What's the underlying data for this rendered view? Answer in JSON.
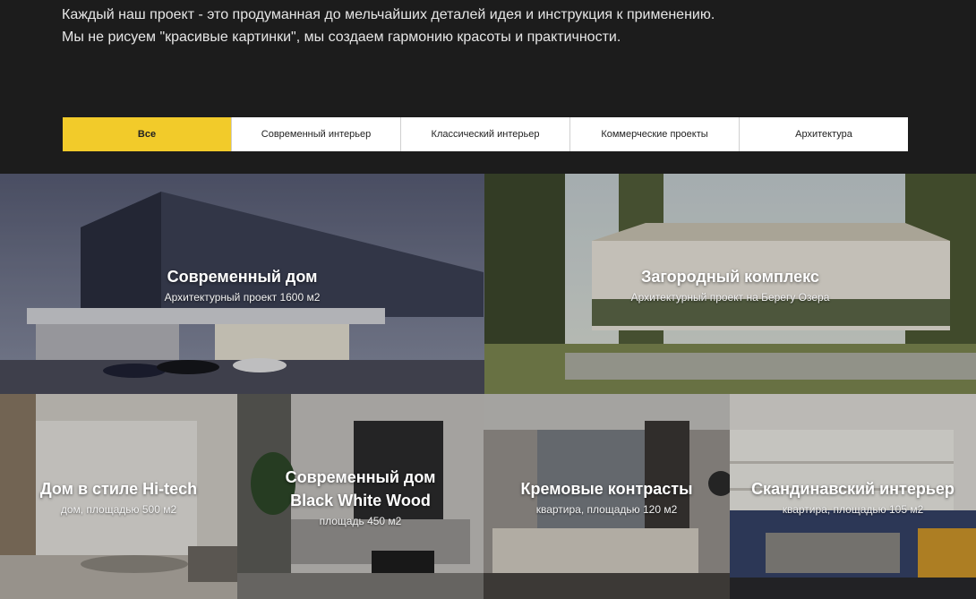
{
  "intro": {
    "line1": "Каждый наш проект - это продуманная до мельчайших деталей идея и инструкция к применению.",
    "line2": "Мы не рисуем \"красивые картинки\", мы создаем гармонию красоты и практичности."
  },
  "filters": [
    {
      "label": "Все",
      "active": true
    },
    {
      "label": "Современный интерьер",
      "active": false
    },
    {
      "label": "Классический интерьер",
      "active": false
    },
    {
      "label": "Коммерческие проекты",
      "active": false
    },
    {
      "label": "Архитектура",
      "active": false
    }
  ],
  "colors": {
    "accent": "#f2cb2a",
    "background": "#1c1c1c"
  },
  "projects": [
    {
      "title": "Современный дом",
      "subtitle": "Архитектурный проект 1600 м2"
    },
    {
      "title": "Загородный комплекс",
      "subtitle": "Архитектурный проект на Берегу Озера"
    },
    {
      "title": "Дом в стиле Hi-tech",
      "subtitle": "дом, площадью 500 м2"
    },
    {
      "title_line1": "Современный дом",
      "title_line2": "Black White Wood",
      "subtitle": "площадь 450 м2"
    },
    {
      "title": "Кремовые контрасты",
      "subtitle": "квартира, площадью 120 м2"
    },
    {
      "title": "Скандинавский интерьер",
      "subtitle": "квартира, площадью 105 м2"
    }
  ]
}
